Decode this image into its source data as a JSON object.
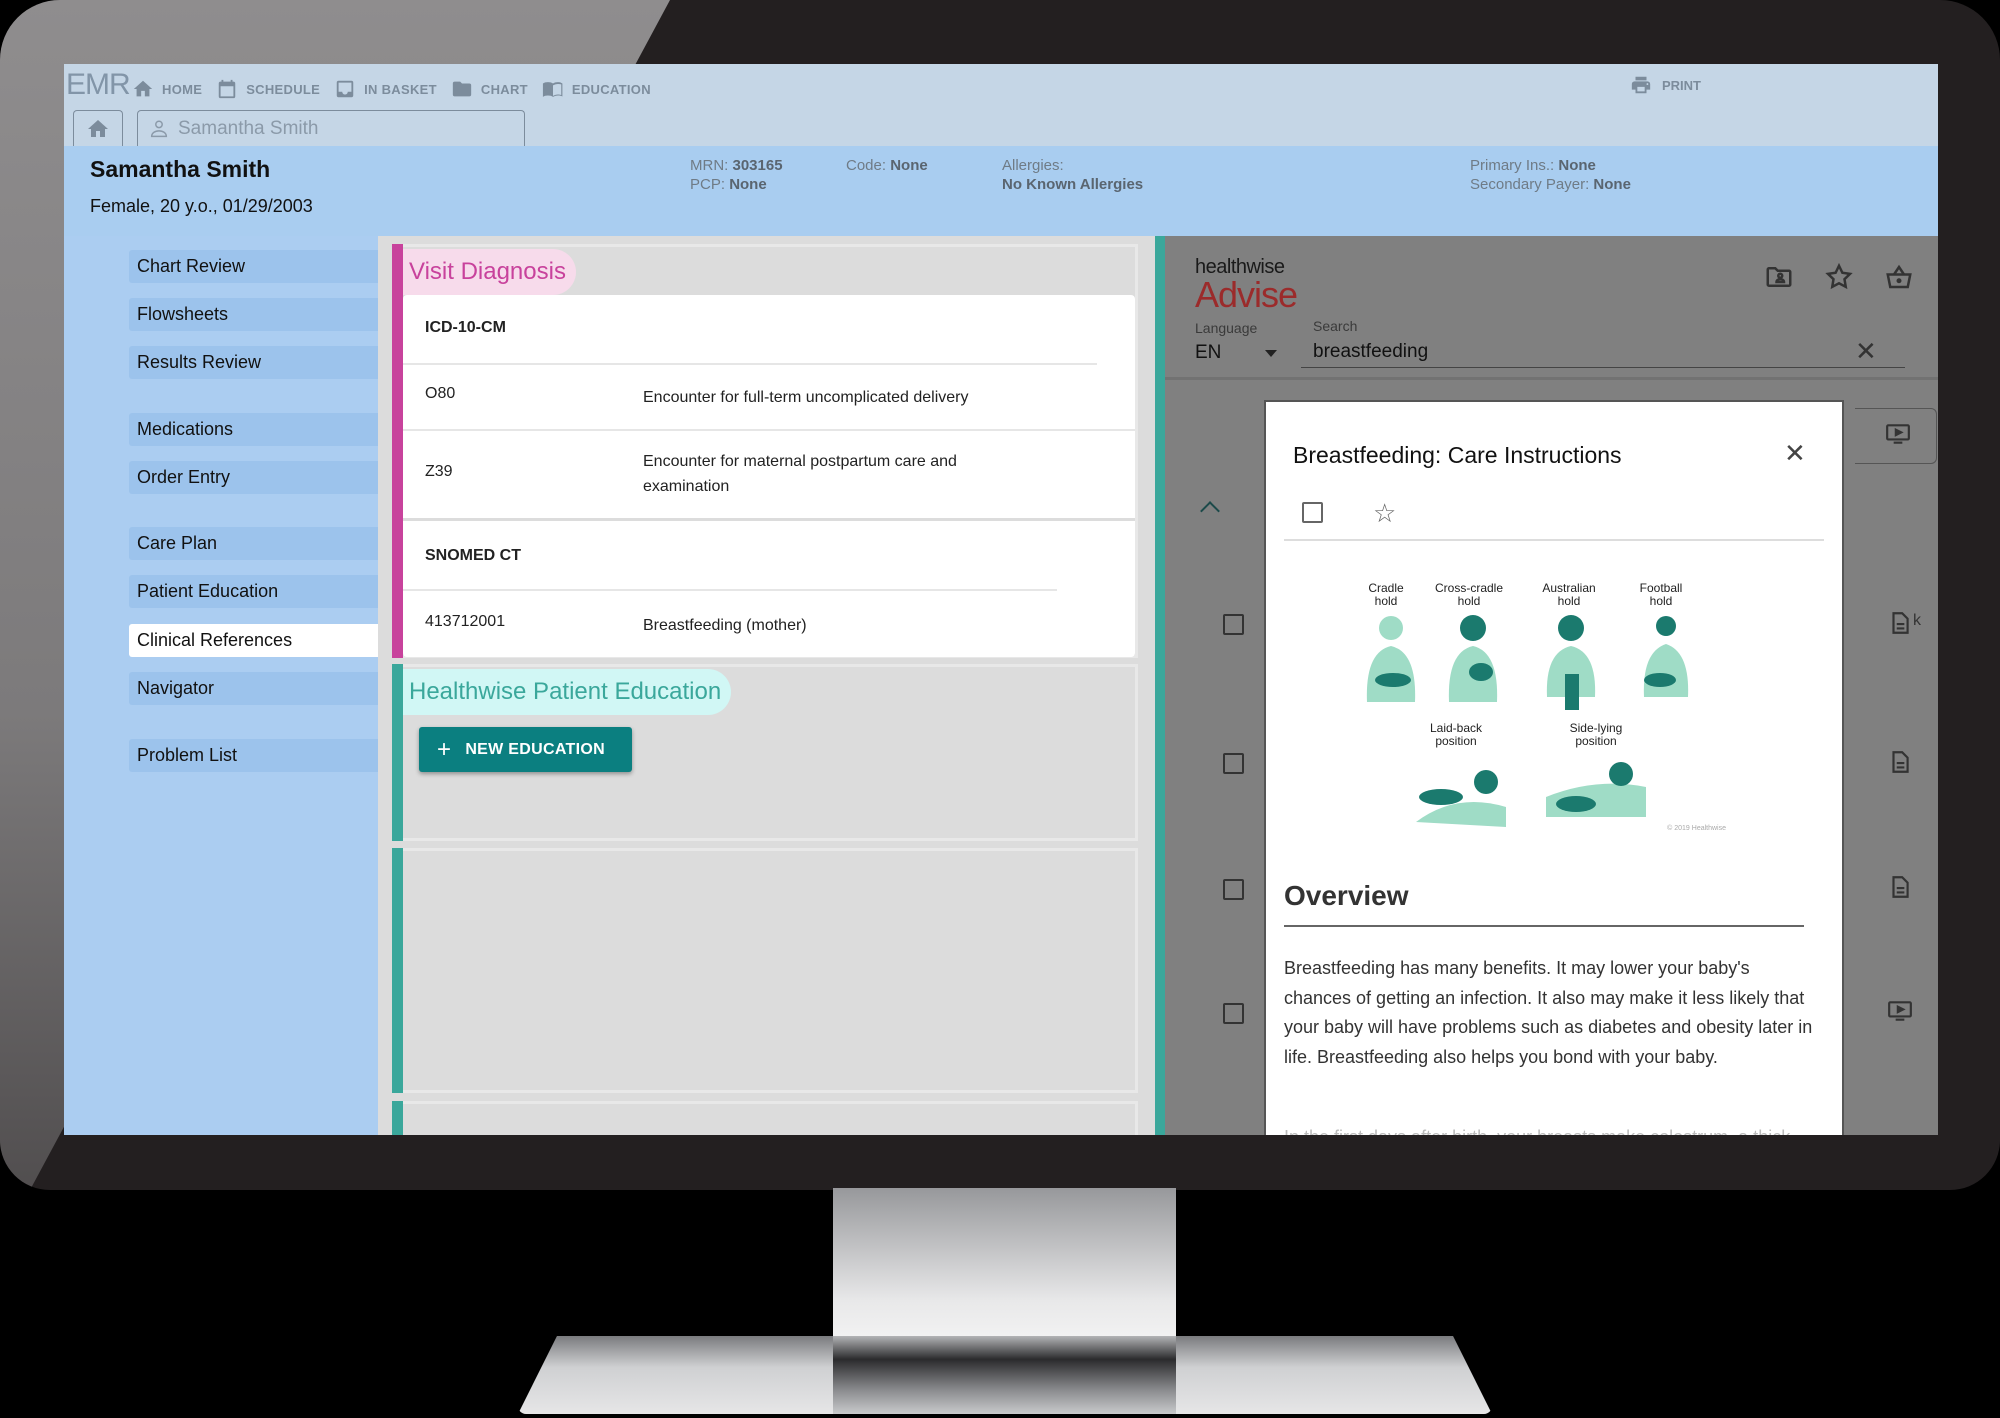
{
  "app": {
    "logo": "EMR",
    "nav": [
      {
        "label": "HOME",
        "icon": "home-icon"
      },
      {
        "label": "SCHEDULE",
        "icon": "calendar-icon"
      },
      {
        "label": "IN BASKET",
        "icon": "inbox-icon"
      },
      {
        "label": "CHART",
        "icon": "folder-icon"
      },
      {
        "label": "EDUCATION",
        "icon": "book-icon"
      }
    ],
    "print_label": "PRINT",
    "patient_tab_label": "Samantha Smith"
  },
  "patient": {
    "name": "Samantha Smith",
    "demographics": "Female, 20 y.o., 01/29/2003",
    "mrn_label": "MRN:",
    "mrn": "303165",
    "pcp_label": "PCP:",
    "pcp": "None",
    "code_label": "Code:",
    "code": "None",
    "allergies_label": "Allergies:",
    "allergies": "No Known Allergies",
    "primary_ins_label": "Primary Ins.:",
    "primary_ins": "None",
    "secondary_payer_label": "Secondary Payer:",
    "secondary_payer": "None"
  },
  "sidebar": {
    "items": [
      {
        "label": "Chart Review",
        "active": false
      },
      {
        "label": "Flowsheets",
        "active": false
      },
      {
        "label": "Results Review",
        "active": false
      },
      {
        "label": "Medications",
        "active": false
      },
      {
        "label": "Order Entry",
        "active": false
      },
      {
        "label": "Care Plan",
        "active": false
      },
      {
        "label": "Patient Education",
        "active": false
      },
      {
        "label": "Clinical References",
        "active": true
      },
      {
        "label": "Navigator",
        "active": false
      },
      {
        "label": "Problem List",
        "active": false
      }
    ]
  },
  "visit_diagnosis": {
    "title": "Visit Diagnosis",
    "accent_color": "#c8429c",
    "groups": [
      {
        "system": "ICD-10-CM",
        "rows": [
          {
            "code": "O80",
            "description": "Encounter for full-term uncomplicated delivery"
          },
          {
            "code": "Z39",
            "description": "Encounter for maternal postpartum care and examination"
          }
        ]
      },
      {
        "system": "SNOMED CT",
        "rows": [
          {
            "code": "413712001",
            "description": "Breastfeeding (mother)"
          }
        ]
      }
    ]
  },
  "patient_education": {
    "title": "Healthwise Patient Education",
    "accent_color": "#3aa79b",
    "new_button_label": "NEW EDUCATION"
  },
  "healthwise": {
    "brand_top": "healthwise",
    "brand_main": "Advise",
    "language_label": "Language",
    "language_value": "EN",
    "search_label": "Search",
    "search_value": "breastfeeding",
    "header_icons": [
      "patient-folder-icon",
      "star-icon",
      "basket-icon"
    ],
    "result_fragment": "k",
    "result_icons": [
      "document-icon",
      "document-icon",
      "document-icon",
      "video-icon"
    ]
  },
  "modal": {
    "title": "Breastfeeding: Care Instructions",
    "illustration": {
      "labels": [
        "Cradle hold",
        "Cross-cradle hold",
        "Australian hold",
        "Football hold",
        "Laid-back position",
        "Side-lying position"
      ],
      "copyright": "© 2019 Healthwise"
    },
    "section_heading": "Overview",
    "paragraph": "Breastfeeding has many benefits. It may lower your baby's chances of getting an infection. It also may make it less likely that your baby will have problems such as diabetes and obesity later in life. Breastfeeding also helps you bond with your baby.",
    "paragraph_next": "In the first days after birth, your breasts make colostrum, a thick"
  }
}
